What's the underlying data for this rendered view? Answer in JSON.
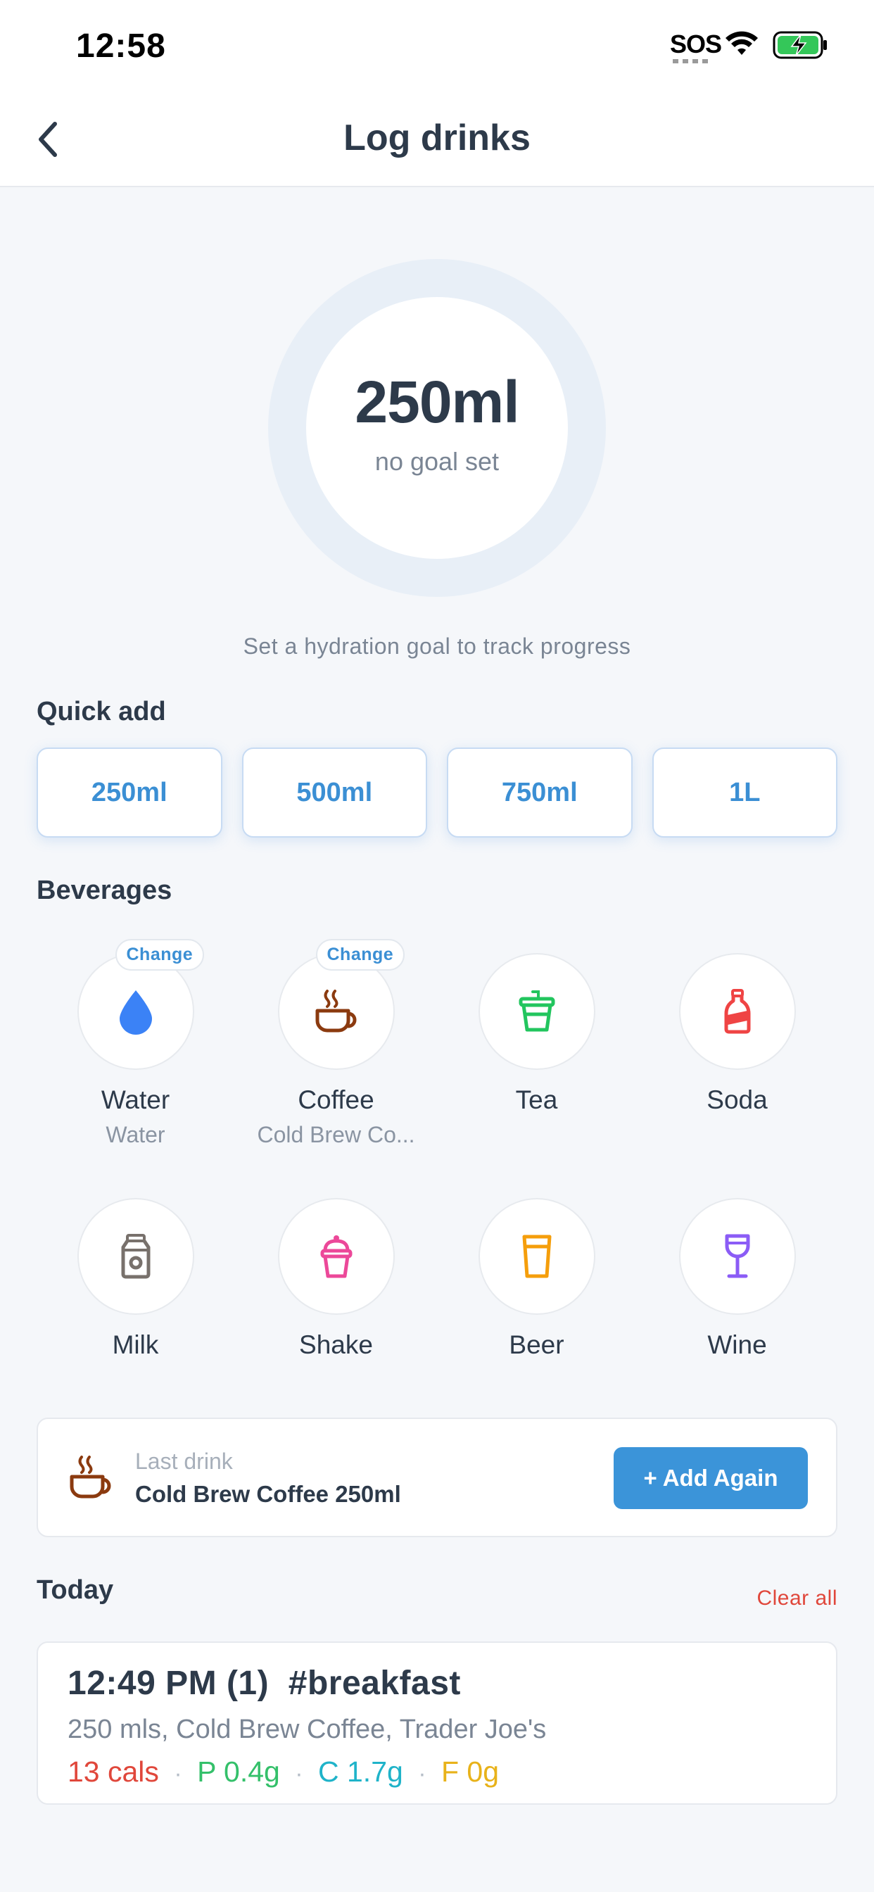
{
  "status_bar": {
    "time": "12:58",
    "sos": "SOS",
    "icons": [
      "wifi-icon",
      "battery-charging-icon"
    ]
  },
  "nav": {
    "title": "Log drinks",
    "back_icon": "chevron-left-icon"
  },
  "progress": {
    "value": "250ml",
    "subtitle": "no goal set",
    "hint": "Set a hydration goal to track progress"
  },
  "quick_add": {
    "title": "Quick add",
    "buttons": [
      "250ml",
      "500ml",
      "750ml",
      "1L"
    ]
  },
  "beverages": {
    "title": "Beverages",
    "change_label": "Change",
    "items": [
      {
        "label": "Water",
        "sub": "Water",
        "icon": "water-drop-icon",
        "color": "#3b82f6",
        "changeable": true
      },
      {
        "label": "Coffee",
        "sub": "Cold Brew Co...",
        "icon": "coffee-cup-icon",
        "color": "#8b3a0f",
        "changeable": true
      },
      {
        "label": "Tea",
        "sub": "",
        "icon": "tea-cup-icon",
        "color": "#22c55e",
        "changeable": false
      },
      {
        "label": "Soda",
        "sub": "",
        "icon": "soda-bottle-icon",
        "color": "#ef4444",
        "changeable": false
      },
      {
        "label": "Milk",
        "sub": "",
        "icon": "milk-carton-icon",
        "color": "#78716c",
        "changeable": false
      },
      {
        "label": "Shake",
        "sub": "",
        "icon": "shake-cup-icon",
        "color": "#ec4899",
        "changeable": false
      },
      {
        "label": "Beer",
        "sub": "",
        "icon": "beer-glass-icon",
        "color": "#f59e0b",
        "changeable": false
      },
      {
        "label": "Wine",
        "sub": "",
        "icon": "wine-glass-icon",
        "color": "#8b5cf6",
        "changeable": false
      }
    ]
  },
  "last_drink": {
    "caption": "Last drink",
    "name": "Cold Brew Coffee 250ml",
    "button": "+ Add Again",
    "icon": "coffee-cup-icon"
  },
  "today": {
    "title": "Today",
    "clear_all": "Clear all",
    "entries": [
      {
        "title": "12:49 PM (1)  #breakfast",
        "desc": "250 mls, Cold Brew Coffee, Trader Joe's",
        "cals": "13 cals",
        "protein": "P 0.4g",
        "carbs": "C 1.7g",
        "fat": "F 0g",
        "separator": "·"
      }
    ]
  },
  "colors": {
    "accent": "#3b94d9",
    "calories": "#e0473b",
    "protein": "#34c06a",
    "carbs": "#1fb3c9",
    "fat": "#e8b21a"
  }
}
